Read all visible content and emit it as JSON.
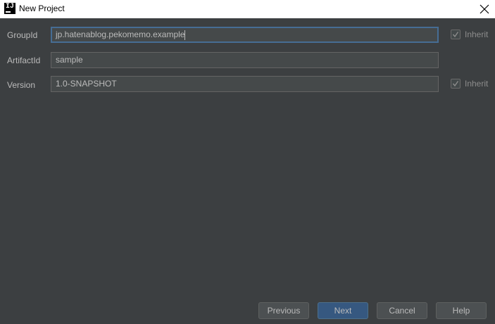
{
  "window": {
    "title": "New Project",
    "app_icon_text": "IJ"
  },
  "form": {
    "group_id": {
      "label": "GroupId",
      "value": "jp.hatenablog.pekomemo.example",
      "inherit_label": "Inherit",
      "inherit_checked": true
    },
    "artifact_id": {
      "label": "ArtifactId",
      "value": "sample"
    },
    "version": {
      "label": "Version",
      "value": "1.0-SNAPSHOT",
      "inherit_label": "Inherit",
      "inherit_checked": true
    }
  },
  "buttons": {
    "previous": "Previous",
    "next": "Next",
    "cancel": "Cancel",
    "help": "Help"
  },
  "colors": {
    "background": "#3c3f41",
    "field_background": "#45494a",
    "focus_border": "#466d94",
    "primary_button": "#365880"
  }
}
